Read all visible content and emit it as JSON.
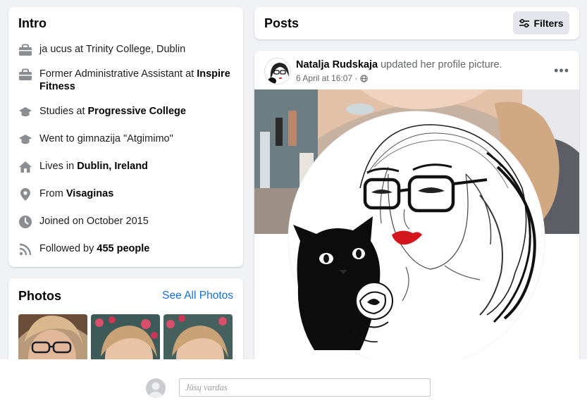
{
  "intro": {
    "title": "Intro",
    "items": [
      {
        "icon": "briefcase-icon",
        "pre": "ja ucus at Trinity College, Dublin",
        "bold": "",
        "post": ""
      },
      {
        "icon": "briefcase-icon",
        "pre": "Former Administrative Assistant at ",
        "bold": "Inspire Fitness",
        "post": ""
      },
      {
        "icon": "graduation-cap-icon",
        "pre": "Studies at ",
        "bold": "Progressive College",
        "post": ""
      },
      {
        "icon": "graduation-cap-icon",
        "pre": "Went to gimnazija \"Atgimimo\"",
        "bold": "",
        "post": ""
      },
      {
        "icon": "home-icon",
        "pre": "Lives in ",
        "bold": "Dublin, Ireland",
        "post": ""
      },
      {
        "icon": "location-pin-icon",
        "pre": "From ",
        "bold": "Visaginas",
        "post": ""
      },
      {
        "icon": "clock-icon",
        "pre": "Joined on October 2015",
        "bold": "",
        "post": ""
      },
      {
        "icon": "rss-icon",
        "pre": "Followed by ",
        "bold": "455 people",
        "post": ""
      }
    ]
  },
  "photos": {
    "title": "Photos",
    "see_all": "See All Photos"
  },
  "posts": {
    "title": "Posts",
    "filters_label": "Filters"
  },
  "post": {
    "author": "Natalja Rudskaja",
    "action": " updated her profile picture.",
    "timestamp": "6 April at 16:07 ·",
    "more": "•••"
  },
  "comment": {
    "placeholder": "Jūsų vardas"
  },
  "colors": {
    "link": "#1a6ed8",
    "icon": "#8a8d91",
    "lips": "#d3161c"
  }
}
